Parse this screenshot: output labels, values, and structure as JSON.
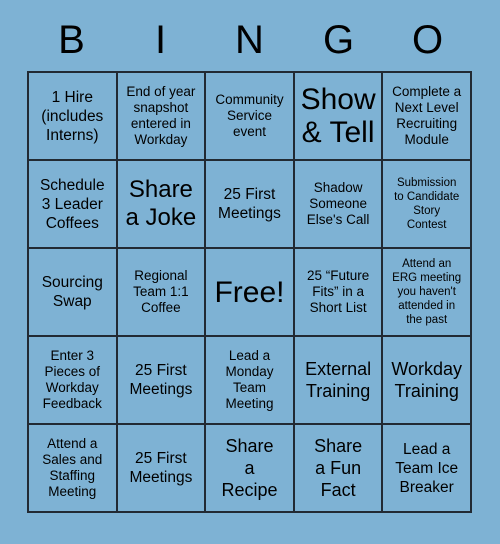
{
  "card": {
    "title": "BINGO",
    "background_color": "#7eb2d4",
    "grid_line_color": "#222a33",
    "text_color": "#000000",
    "columns": 5,
    "rows": 5
  },
  "header": {
    "letters": [
      "B",
      "I",
      "N",
      "G",
      "O"
    ]
  },
  "grid": {
    "cells": [
      {
        "text": "1 Hire\n(includes\nInterns)",
        "size": "md",
        "row": 1,
        "col": "B"
      },
      {
        "text": "End of year\nsnapshot\nentered in\nWorkday",
        "size": "sm",
        "row": 1,
        "col": "I"
      },
      {
        "text": "Community\nService\nevent",
        "size": "sm",
        "row": 1,
        "col": "N"
      },
      {
        "text": "Show\n& Tell",
        "size": "xxl",
        "row": 1,
        "col": "G"
      },
      {
        "text": "Complete a\nNext Level\nRecruiting\nModule",
        "size": "sm",
        "row": 1,
        "col": "O"
      },
      {
        "text": "Schedule\n3 Leader\nCoffees",
        "size": "md",
        "row": 2,
        "col": "B"
      },
      {
        "text": "Share\na Joke",
        "size": "xl",
        "row": 2,
        "col": "I"
      },
      {
        "text": "25 First\nMeetings",
        "size": "md",
        "row": 2,
        "col": "N"
      },
      {
        "text": "Shadow\nSomeone\nElse's Call",
        "size": "sm",
        "row": 2,
        "col": "G"
      },
      {
        "text": "Submission\nto Candidate\nStory\nContest",
        "size": "xs",
        "row": 2,
        "col": "O"
      },
      {
        "text": "Sourcing\nSwap",
        "size": "md",
        "row": 3,
        "col": "B"
      },
      {
        "text": "Regional\nTeam 1:1\nCoffee",
        "size": "sm",
        "row": 3,
        "col": "I"
      },
      {
        "text": "Free!",
        "size": "xxl",
        "row": 3,
        "col": "N"
      },
      {
        "text": "25 “Future\nFits” in a\nShort List",
        "size": "sm",
        "row": 3,
        "col": "G"
      },
      {
        "text": "Attend an\nERG meeting\nyou haven't\nattended in\nthe past",
        "size": "xs",
        "row": 3,
        "col": "O"
      },
      {
        "text": "Enter 3\nPieces of\nWorkday\nFeedback",
        "size": "sm",
        "row": 4,
        "col": "B"
      },
      {
        "text": "25 First\nMeetings",
        "size": "md",
        "row": 4,
        "col": "I"
      },
      {
        "text": "Lead a\nMonday\nTeam\nMeeting",
        "size": "sm",
        "row": 4,
        "col": "N"
      },
      {
        "text": "External\nTraining",
        "size": "lg",
        "row": 4,
        "col": "G"
      },
      {
        "text": "Workday\nTraining",
        "size": "lg",
        "row": 4,
        "col": "O"
      },
      {
        "text": "Attend a\nSales and\nStaffing\nMeeting",
        "size": "sm",
        "row": 5,
        "col": "B"
      },
      {
        "text": "25 First\nMeetings",
        "size": "md",
        "row": 5,
        "col": "I"
      },
      {
        "text": "Share\na\nRecipe",
        "size": "lg",
        "row": 5,
        "col": "N"
      },
      {
        "text": "Share\na Fun\nFact",
        "size": "lg",
        "row": 5,
        "col": "G"
      },
      {
        "text": "Lead a\nTeam Ice\nBreaker",
        "size": "md",
        "row": 5,
        "col": "O"
      }
    ]
  }
}
